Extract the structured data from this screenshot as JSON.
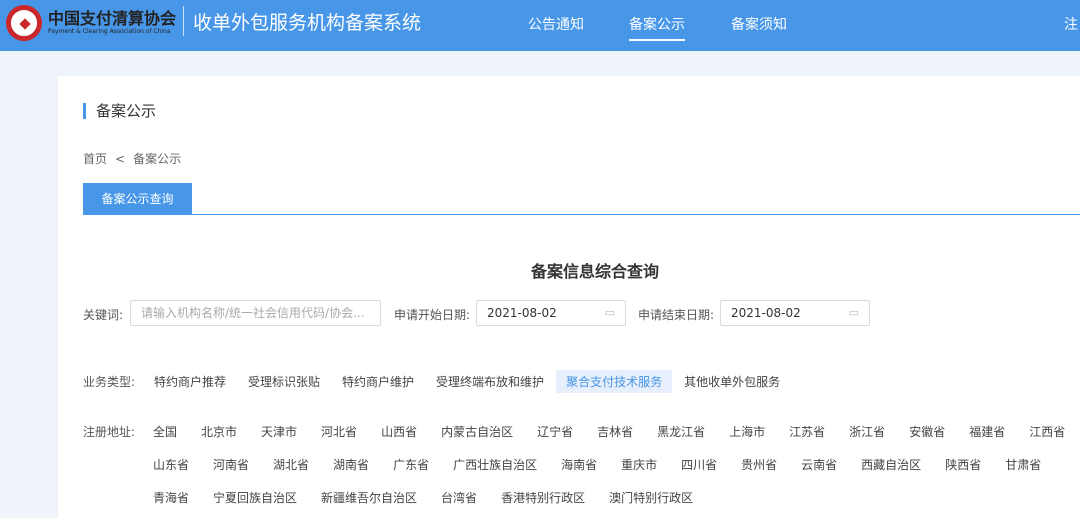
{
  "header": {
    "org_name": "中国支付清算协会",
    "org_name_en": "Payment & Clearing Association of China",
    "system_title": "收单外包服务机构备案系统",
    "nav": [
      {
        "label": "公告通知"
      },
      {
        "label": "备案公示",
        "active": true
      },
      {
        "label": "备案须知"
      },
      {
        "label": "注"
      }
    ]
  },
  "page": {
    "title": "备案公示",
    "breadcrumb": [
      "首页",
      "<",
      "备案公示"
    ],
    "tab": "备案公示查询",
    "query_title": "备案信息综合查询"
  },
  "filters": {
    "keyword_label": "关键词:",
    "keyword_placeholder": "请输入机构名称/统一社会信用代码/协会...",
    "start_label": "申请开始日期:",
    "start_value": "2021-08-02",
    "end_label": "申请结束日期:",
    "end_value": "2021-08-02"
  },
  "business": {
    "label": "业务类型:",
    "options": [
      "特约商户推荐",
      "受理标识张贴",
      "特约商户维护",
      "受理终端布放和维护",
      "聚合支付技术服务",
      "其他收单外包服务"
    ],
    "selected": 4
  },
  "region": {
    "label": "注册地址:",
    "rows": [
      [
        "全国",
        "北京市",
        "天津市",
        "河北省",
        "山西省",
        "内蒙古自治区",
        "辽宁省",
        "吉林省",
        "黑龙江省",
        "上海市",
        "江苏省",
        "浙江省",
        "安徽省",
        "福建省",
        "江西省"
      ],
      [
        "山东省",
        "河南省",
        "湖北省",
        "湖南省",
        "广东省",
        "广西壮族自治区",
        "海南省",
        "重庆市",
        "四川省",
        "贵州省",
        "云南省",
        "西藏自治区",
        "陕西省",
        "甘肃省"
      ],
      [
        "青海省",
        "宁夏回族自治区",
        "新疆维吾尔自治区",
        "台湾省",
        "香港特别行政区",
        "澳门特别行政区"
      ]
    ]
  },
  "colors": {
    "primary": "#4796e8",
    "seal": "#c9272c"
  }
}
